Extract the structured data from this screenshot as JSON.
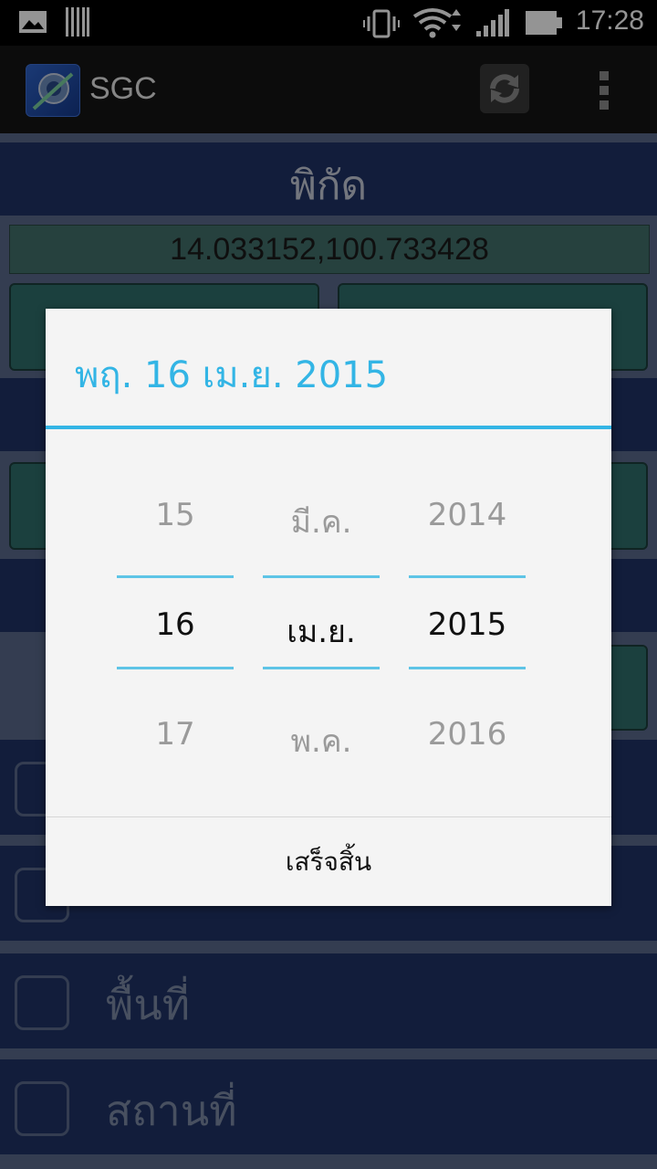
{
  "status_bar": {
    "time": "17:28",
    "icons": [
      "image-icon",
      "barcode-icon",
      "vibrate-icon",
      "wifi-icon",
      "signal-icon",
      "battery-icon"
    ]
  },
  "action_bar": {
    "title": "SGC",
    "icons": [
      "app-logo-icon",
      "refresh-icon",
      "overflow-menu-icon"
    ]
  },
  "content": {
    "section_title": "พิกัด",
    "coordinates": "14.033152,100.733428",
    "checklist": [
      {
        "label": "พื้นที่"
      },
      {
        "label": "สถานที่"
      }
    ]
  },
  "date_dialog": {
    "title": "พฤ. 16 เม.ย. 2015",
    "day": {
      "prev": "15",
      "current": "16",
      "next": "17"
    },
    "month": {
      "prev": "มี.ค.",
      "current": "เม.ย.",
      "next": "พ.ค."
    },
    "year": {
      "prev": "2014",
      "current": "2015",
      "next": "2016"
    },
    "done_label": "เสร็จสิ้น"
  },
  "colors": {
    "accent": "#33b5e5",
    "band": "#1f3366",
    "teal_button": "#2f6f6b"
  }
}
